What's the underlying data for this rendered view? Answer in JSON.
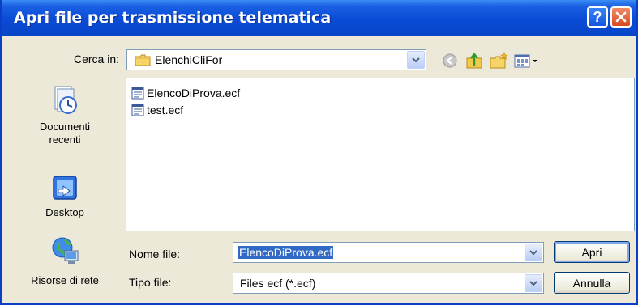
{
  "window": {
    "title": "Apri file per trasmissione telematica",
    "help_label": "?"
  },
  "look_in": {
    "label": "Cerca in:",
    "value": "ElenchiCliFor"
  },
  "places": [
    {
      "label_line1": "Documenti",
      "label_line2": "recenti",
      "icon": "recent-documents-icon"
    },
    {
      "label_line1": "Desktop",
      "label_line2": "",
      "icon": "desktop-icon"
    },
    {
      "label_line1": "Risorse di rete",
      "label_line2": "",
      "icon": "network-icon"
    }
  ],
  "files": [
    {
      "name": "ElencoDiProva.ecf",
      "icon": "document-icon"
    },
    {
      "name": "test.ecf",
      "icon": "document-icon"
    }
  ],
  "file_name": {
    "label": "Nome file:",
    "value": "ElencoDiProva.ecf"
  },
  "file_type": {
    "label": "Tipo file:",
    "value": "Files ecf (*.ecf)"
  },
  "buttons": {
    "open": "Apri",
    "cancel": "Annulla"
  },
  "colors": {
    "title_bar": "#0a4bd6",
    "selection": "#316ac5",
    "dialog_bg": "#ece9d8"
  }
}
